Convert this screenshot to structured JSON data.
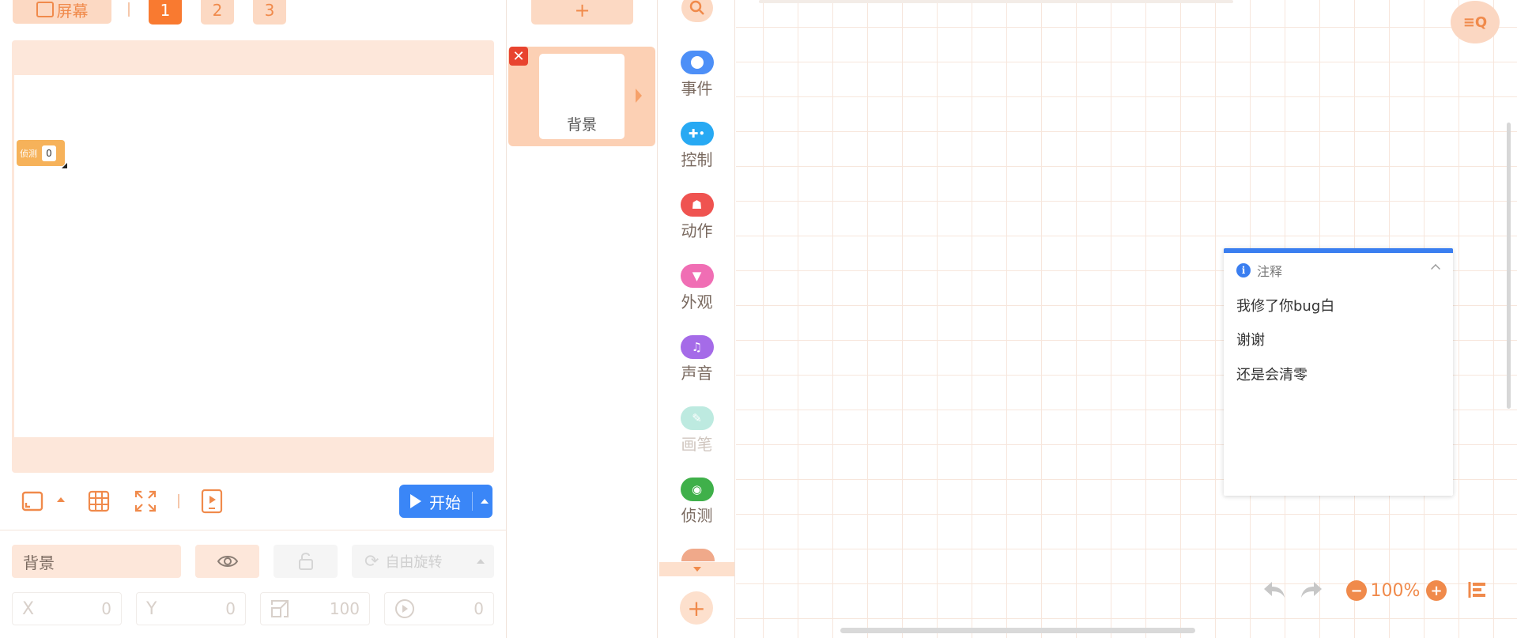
{
  "stage": {
    "screen_label": "屏幕",
    "pages": [
      "1",
      "2",
      "3"
    ],
    "active_page": "1",
    "variable": {
      "name": "侦测",
      "value": "0"
    },
    "start_label": "开始"
  },
  "sprite_props": {
    "name_value": "背景",
    "rotate_label": "自由旋转",
    "x_label": "X",
    "x_value": "0",
    "y_label": "Y",
    "y_value": "0",
    "size_value": "100",
    "direction_value": "0"
  },
  "sprites": {
    "add_label": "+",
    "items": [
      {
        "name": "背景"
      }
    ],
    "delete_label": "✕"
  },
  "categories": [
    {
      "label": "事件",
      "color": "#4d8ff7",
      "icon": "toggle-icon"
    },
    {
      "label": "控制",
      "color": "#27a9f3",
      "icon": "gamepad-icon"
    },
    {
      "label": "动作",
      "color": "#ef5350",
      "icon": "ghost-icon"
    },
    {
      "label": "外观",
      "color": "#f06eb4",
      "icon": "shirt-icon"
    },
    {
      "label": "声音",
      "color": "#a56be8",
      "icon": "music-icon"
    },
    {
      "label": "画笔",
      "color": "#bdeae0",
      "icon": "pen-icon"
    },
    {
      "label": "侦测",
      "color": "#3fb04a",
      "icon": "target-icon"
    }
  ],
  "category_add": "+",
  "note": {
    "title": "注释",
    "lines": [
      "我修了你bug白",
      "谢谢",
      "还是会清零"
    ]
  },
  "zoom": {
    "value": "100%",
    "minus": "−",
    "plus": "+"
  }
}
